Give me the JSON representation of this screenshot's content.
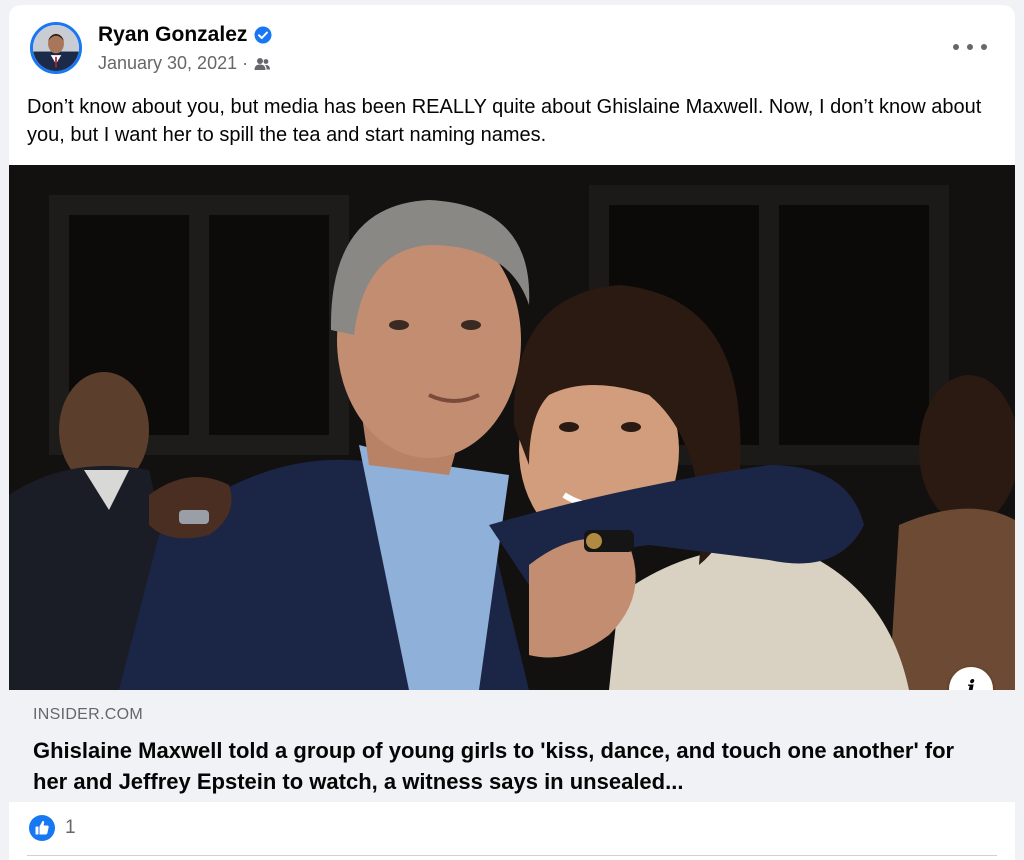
{
  "post": {
    "author": "Ryan Gonzalez",
    "date": "January 30, 2021",
    "separator": "·",
    "text": "Don’t know about you, but media has been REALLY quite about Ghislaine Maxwell. Now, I don’t know about you, but I want her to spill the tea and start naming names.",
    "icons": {
      "verified": "verified-badge-icon",
      "audience": "friends-audience-icon",
      "more": "more-options-icon",
      "info": "info-icon",
      "like": "like-reaction-icon"
    }
  },
  "link_preview": {
    "domain": "INSIDER.COM",
    "headline": "Ghislaine Maxwell told a group of young girls to 'kiss, dance, and touch one another' for her and Jeffrey Epstein to watch, a witness says in unsealed...",
    "info_label": "i"
  },
  "reactions": {
    "count": "1"
  },
  "colors": {
    "brand_blue": "#1877f2",
    "secondary_text": "#65676b",
    "primary_text": "#050505",
    "link_bg": "#f0f2f5"
  }
}
